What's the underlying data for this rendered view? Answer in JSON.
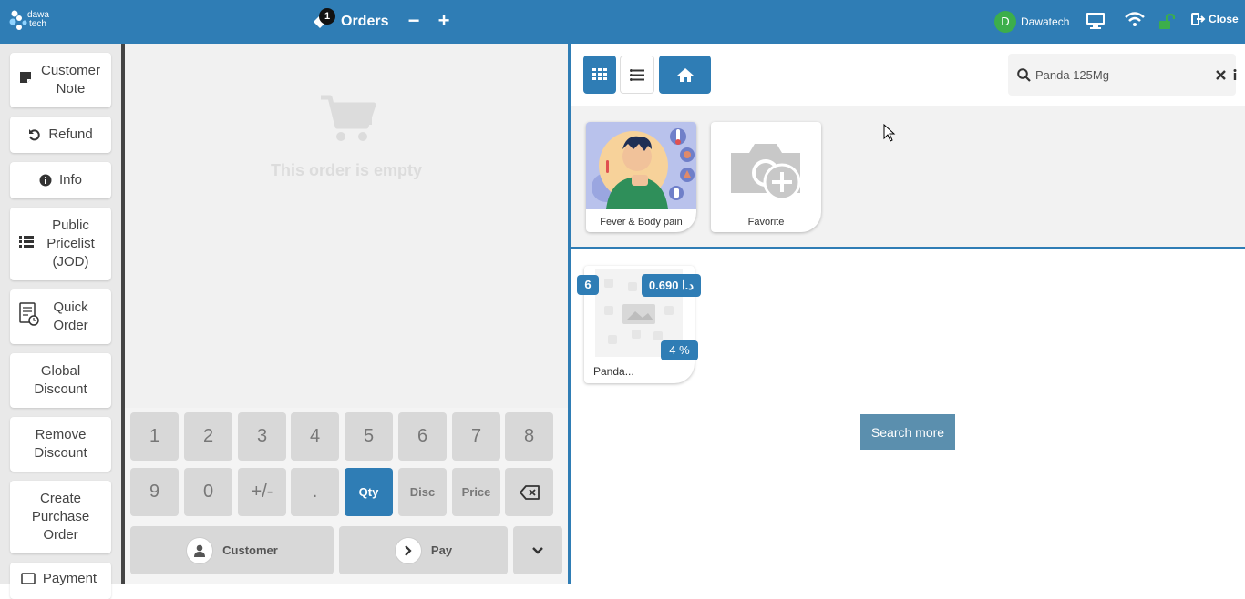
{
  "topbar": {
    "logo_text_1": "dawa",
    "logo_text_2": "tech",
    "orders_count": "1",
    "orders_label": "Orders",
    "minus_label": "−",
    "plus_label": "+",
    "user_initial": "D",
    "user_name": "Dawatech",
    "close_label": "Close"
  },
  "sidebar": {
    "items": [
      {
        "label": "Customer Note",
        "icon": "note-icon"
      },
      {
        "label": "Refund",
        "icon": "undo-icon"
      },
      {
        "label": "Info",
        "icon": "info-icon"
      },
      {
        "label": "Public Pricelist (JOD)",
        "icon": "list-icon"
      },
      {
        "label": "Quick Order",
        "icon": "quick-order-icon"
      },
      {
        "label": "Global Discount",
        "icon": ""
      },
      {
        "label": "Remove Discount",
        "icon": ""
      },
      {
        "label": "Create Purchase Order",
        "icon": ""
      },
      {
        "label": "Payment",
        "icon": "payment-icon"
      }
    ]
  },
  "order": {
    "empty_text": "This order is empty"
  },
  "numpad": {
    "keys": [
      "1",
      "2",
      "3",
      "4",
      "5",
      "6",
      "7",
      "8",
      "9",
      "0",
      "+/-",
      ".",
      "Qty",
      "Disc",
      "Price"
    ],
    "customer_label": "Customer",
    "pay_label": "Pay"
  },
  "right": {
    "search_value": "Panda 125Mg",
    "categories": [
      {
        "label": "Fever & Body pain"
      },
      {
        "label": "Favorite"
      }
    ],
    "product": {
      "name": "Panda...",
      "qty": "6",
      "price": "0.690 د.ا",
      "tax": "4 %"
    },
    "search_more_label": "Search more"
  },
  "colors": {
    "brand": "#2f7db5",
    "avatar": "#3cae4b",
    "lock": "#3cae4b"
  }
}
